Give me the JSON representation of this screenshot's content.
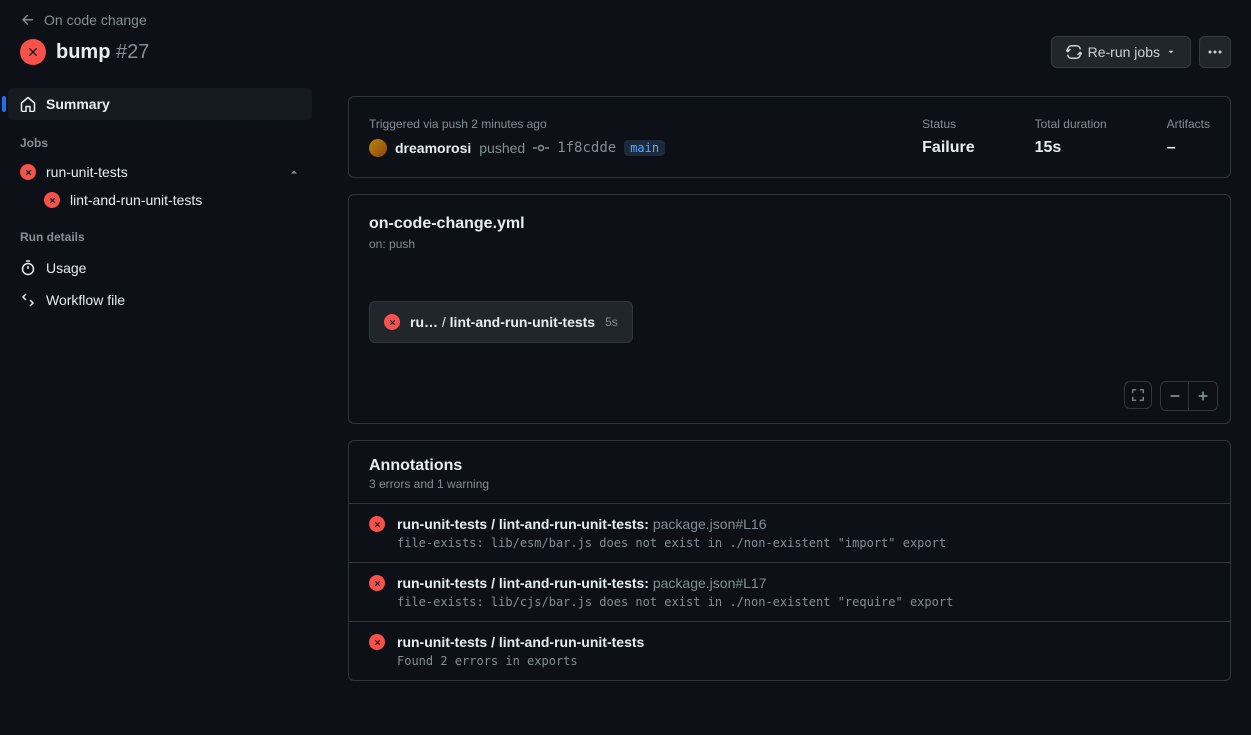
{
  "breadcrumb": {
    "parent": "On code change"
  },
  "run": {
    "title": "bump",
    "number": "#27"
  },
  "actions": {
    "rerun": "Re-run jobs"
  },
  "sidebar": {
    "summary": "Summary",
    "jobs_heading": "Jobs",
    "job_group": "run-unit-tests",
    "job_child": "lint-and-run-unit-tests",
    "run_details_heading": "Run details",
    "usage": "Usage",
    "workflow_file": "Workflow file"
  },
  "summary": {
    "trigger_label": "Triggered via push 2 minutes ago",
    "username": "dreamorosi",
    "action": "pushed",
    "sha": "1f8cdde",
    "branch": "main",
    "status_label": "Status",
    "status_value": "Failure",
    "duration_label": "Total duration",
    "duration_value": "15s",
    "artifacts_label": "Artifacts",
    "artifacts_value": "–"
  },
  "workflow": {
    "filename": "on-code-change.yml",
    "trigger": "on: push",
    "job_prefix": "ru…",
    "job_sep": " / ",
    "job_name": "lint-and-run-unit-tests",
    "job_time": "5s"
  },
  "annotations": {
    "title": "Annotations",
    "subtitle": "3 errors and 1 warning",
    "items": [
      {
        "job": "run-unit-tests / lint-and-run-unit-tests:",
        "location": "package.json#L16",
        "message": "file-exists: lib/esm/bar.js does not exist in ./non-existent \"import\" export"
      },
      {
        "job": "run-unit-tests / lint-and-run-unit-tests:",
        "location": "package.json#L17",
        "message": "file-exists: lib/cjs/bar.js does not exist in ./non-existent \"require\" export"
      },
      {
        "job": "run-unit-tests / lint-and-run-unit-tests",
        "location": "",
        "message": "Found 2 errors in exports"
      }
    ]
  }
}
